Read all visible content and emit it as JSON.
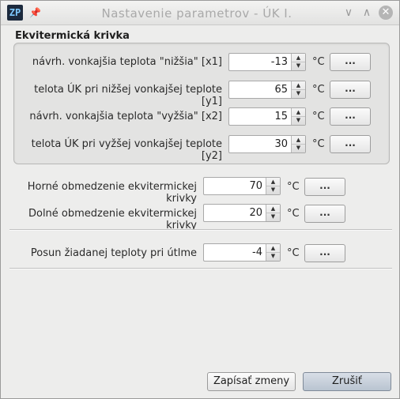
{
  "window": {
    "title": "Nastavenie parametrov - ÚK I.",
    "app_icon_text": "ZP",
    "icons": {
      "app": "app-logo-icon",
      "pin": "pin-icon",
      "minimize": "chevron-down-icon",
      "maximize": "chevron-up-icon",
      "close": "close-icon"
    }
  },
  "group": {
    "title": "Ekvitermická krivka",
    "rows": [
      {
        "label": "návrh. vonkajšia teplota \"nižšia\" [x1]",
        "value": "-13",
        "unit": "°C",
        "button": "..."
      },
      {
        "label": "telota ÚK pri nižšej vonkajšej teplote [y1]",
        "value": "65",
        "unit": "°C",
        "button": "..."
      },
      {
        "label": "návrh. vonkajšia teplota \"vyžšia\" [x2]",
        "value": "15",
        "unit": "°C",
        "button": "..."
      },
      {
        "label": "telota ÚK pri vyžšej vonkajšej teplote [y2]",
        "value": "30",
        "unit": "°C",
        "button": "..."
      }
    ]
  },
  "limits": [
    {
      "label": "Horné obmedzenie ekvitermickej krivky",
      "value": "70",
      "unit": "°C",
      "button": "..."
    },
    {
      "label": "Dolné obmedzenie ekvitermickej krivky",
      "value": "20",
      "unit": "°C",
      "button": "..."
    }
  ],
  "offset": {
    "label": "Posun žiadanej teploty pri útlme",
    "value": "-4",
    "unit": "°C",
    "button": "..."
  },
  "footer": {
    "save_label": "Zapísať zmeny",
    "cancel_label": "Zrušiť"
  }
}
